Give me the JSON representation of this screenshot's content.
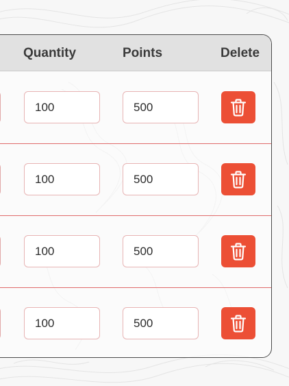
{
  "table": {
    "headers": {
      "quantity": "Quantity",
      "points": "Points",
      "delete": "Delete"
    },
    "rows": [
      {
        "quantity": "100",
        "points": "500"
      },
      {
        "quantity": "100",
        "points": "500"
      },
      {
        "quantity": "100",
        "points": "500"
      },
      {
        "quantity": "100",
        "points": "500"
      }
    ],
    "delete_icon": "trash-icon"
  },
  "colors": {
    "accent_red": "#ec4f35",
    "header_bg": "#e1e1e1",
    "row_divider": "#e06a6a",
    "input_border": "#e7b3b3"
  }
}
